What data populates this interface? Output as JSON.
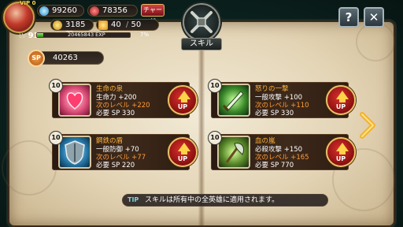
{
  "player": {
    "vip": "VIP 0",
    "level_label": "LV",
    "level": "91",
    "gems": "99260",
    "tickets": "78356",
    "charge_label": "チャージ",
    "gold": "3185万",
    "stamina": "40",
    "stamina_max": "50",
    "exp_text": "20465843 EXP",
    "exp_percent": "7%",
    "exp_fraction": 0.07
  },
  "screen": {
    "title": "スキル"
  },
  "buttons": {
    "help": "?",
    "close": "✕"
  },
  "sp": {
    "badge": "SP",
    "value": "40263"
  },
  "skills": [
    {
      "level": "10",
      "name": "生命の泉",
      "line1": "生命力 +200",
      "line2": "次のレベル +220",
      "line3": "必要 SP 330",
      "up_label": "UP",
      "icon": "heart-fountain-icon"
    },
    {
      "level": "10",
      "name": "怒りの一撃",
      "line1": "一般攻撃 +100",
      "line2": "次のレベル +110",
      "line3": "必要 SP 330",
      "up_label": "UP",
      "icon": "sword-strike-icon"
    },
    {
      "level": "10",
      "name": "鋼鉄の盾",
      "line1": "一般防御 +70",
      "line2": "次のレベル +77",
      "line3": "必要 SP 220",
      "up_label": "UP",
      "icon": "steel-shield-icon"
    },
    {
      "level": "10",
      "name": "血の嵐",
      "line1": "必殺攻撃 +150",
      "line2": "次のレベル +165",
      "line3": "必要 SP 770",
      "up_label": "UP",
      "icon": "blood-axe-icon"
    }
  ],
  "tip": {
    "label": "TIP",
    "text": "スキルは所有中の全英雄に適用されます。"
  },
  "colors": {
    "accent_gold": "#ffb43a",
    "next_level_orange": "#ff9a3a",
    "up_button_red": "#b3201f"
  }
}
